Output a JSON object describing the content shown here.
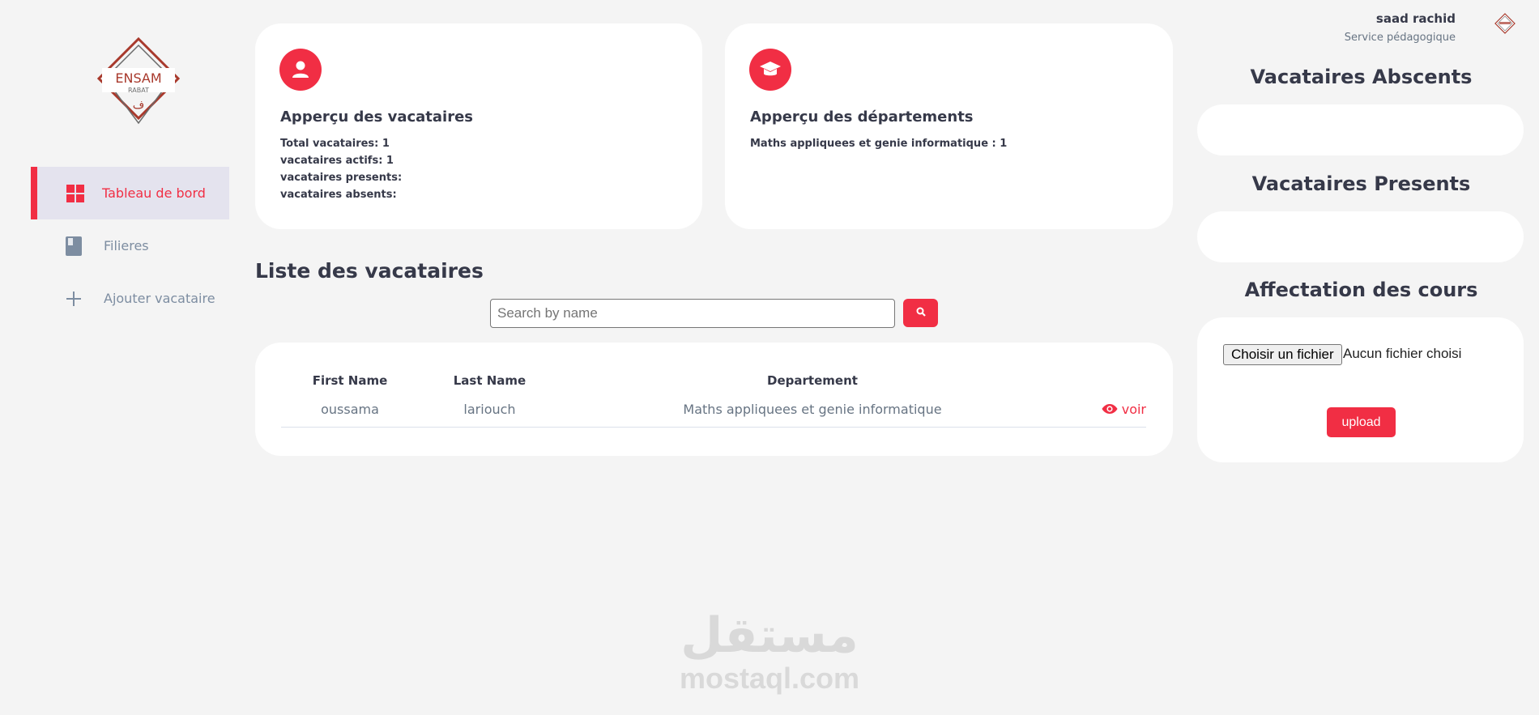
{
  "sidebar": {
    "logo": {
      "text": "ENSAM",
      "subtext": "RABAT"
    },
    "items": [
      {
        "label": "Tableau de bord",
        "icon": "grid-icon",
        "active": true
      },
      {
        "label": "Filieres",
        "icon": "book-icon",
        "active": false
      },
      {
        "label": "Ajouter vacataire",
        "icon": "plus-icon",
        "active": false
      }
    ]
  },
  "overview": {
    "vacataires": {
      "title": "Apperçu des vacataires",
      "icon": "user-icon",
      "stats": [
        "Total vacataires: 1",
        "vacataires actifs: 1",
        "vacataires presents:",
        "vacataires absents:"
      ]
    },
    "departements": {
      "title": "Apperçu des départements",
      "icon": "graduation-cap-icon",
      "stats": [
        "Maths appliquees et genie informatique : 1"
      ]
    }
  },
  "list": {
    "title": "Liste des vacataires",
    "search_placeholder": "Search by name",
    "search_icon": "search-icon",
    "columns": [
      "First Name",
      "Last Name",
      "Departement",
      ""
    ],
    "rows": [
      {
        "first_name": "oussama",
        "last_name": "lariouch",
        "departement": "Maths appliquees et genie informatique",
        "action": "voir"
      }
    ]
  },
  "user": {
    "name": "saad rachid",
    "role": "Service pédagogique"
  },
  "right": {
    "absent_title": "Vacataires Abscents",
    "present_title": "Vacataires Presents",
    "affectation_title": "Affectation des cours",
    "file_button": "Choisir un fichier",
    "file_status": "Aucun fichier choisi",
    "upload_label": "upload"
  },
  "watermark": {
    "arabic": "مستقل",
    "latin": "mostaql.com"
  },
  "colors": {
    "accent": "#f12e44",
    "background": "#f4f4f4",
    "text": "#363949",
    "muted": "#7d8da1"
  }
}
